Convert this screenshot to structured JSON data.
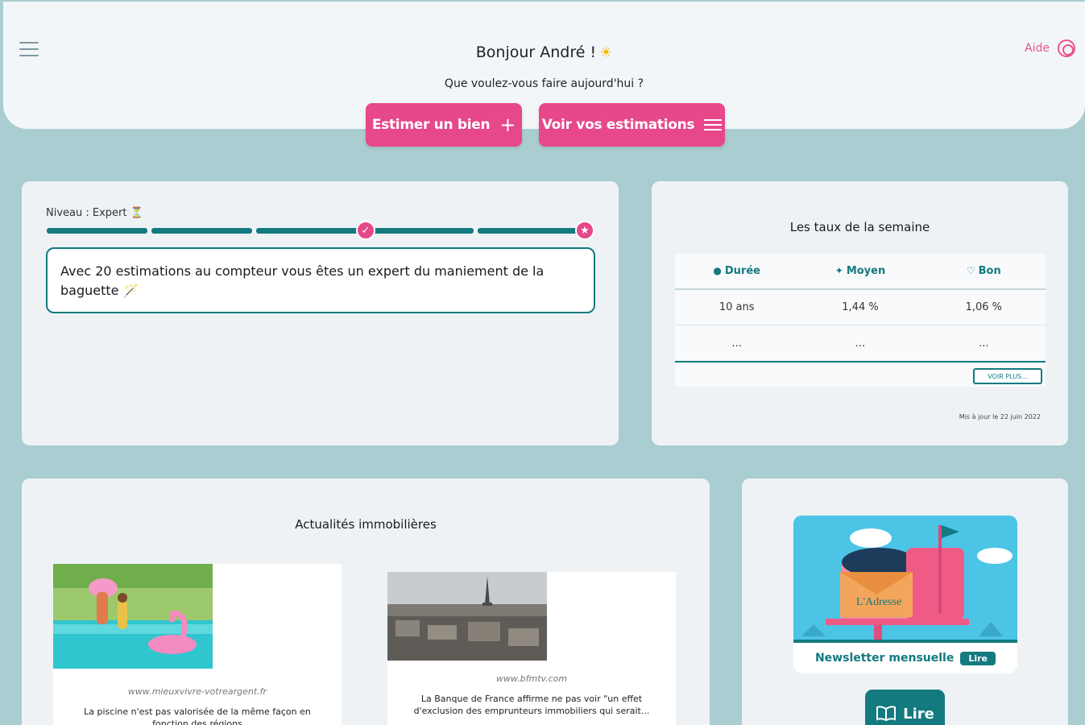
{
  "header": {
    "greeting": "Bonjour André !",
    "greeting_emoji": "☀",
    "subtitle": "Que voulez-vous faire aujourd'hui ?",
    "help_label": "Aide",
    "estimate_button": "Estimer un bien",
    "view_button": "Voir vos estimations"
  },
  "level": {
    "label": "Niveau : Expert",
    "emoji": "⏳",
    "progress_steps_total": 5,
    "progress_steps_done": 5,
    "message": "Avec 20 estimations au compteur vous êtes un expert du maniement de la baguette",
    "message_emoji": "🪄"
  },
  "rates": {
    "title": "Les taux de la semaine",
    "columns": [
      {
        "icon": "●",
        "label": "Durée"
      },
      {
        "icon": "✦",
        "label": "Moyen"
      },
      {
        "icon": "♡",
        "label": "Bon"
      }
    ],
    "rows": [
      [
        "10 ans",
        "1,44 %",
        "1,06 %"
      ],
      [
        "...",
        "...",
        "..."
      ]
    ],
    "see_more": "VOIR PLUS...",
    "updated": "Mis à jour le 22 juin 2022"
  },
  "news": {
    "title": "Actualités immobilières",
    "items": [
      {
        "source": "www.mieuxvivre-votreargent.fr",
        "text": "La piscine n'est pas valorisée de la même façon en fonction des régions"
      },
      {
        "source": "www.bfmtv.com",
        "text": "La Banque de France affirme ne pas voir \"un effet d'exclusion des emprunteurs immobiliers qui serait..."
      }
    ]
  },
  "newsletter": {
    "band_text": "Newsletter mensuelle",
    "band_button": "Lire",
    "envelope_logo": "L'Adresse",
    "read_button": "Lire"
  },
  "colors": {
    "accent": "#e6488a",
    "teal": "#137a80",
    "background": "#a9cdd0"
  }
}
